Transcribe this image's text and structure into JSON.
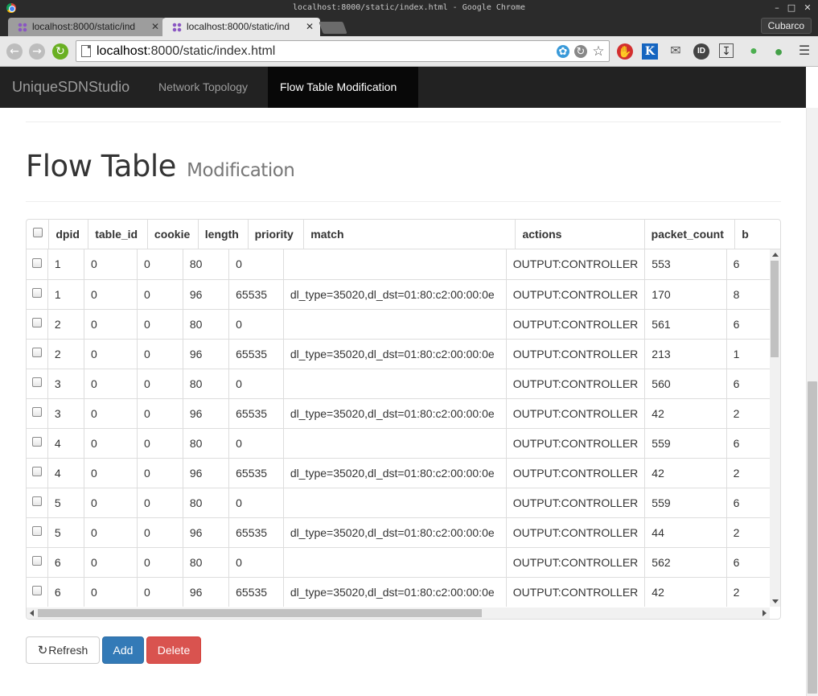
{
  "window": {
    "title": "localhost:8000/static/index.html - Google Chrome",
    "profile": "Cubarco"
  },
  "tabs": [
    {
      "label": "localhost:8000/static/ind",
      "active": false
    },
    {
      "label": "localhost:8000/static/ind",
      "active": true
    }
  ],
  "address_bar": {
    "host": "localhost",
    "path": ":8000/static/index.html"
  },
  "navbar": {
    "brand": "UniqueSDNStudio",
    "links": [
      {
        "label": "Network Topology",
        "active": false
      },
      {
        "label": "Flow Table Modification",
        "active": true
      }
    ]
  },
  "page": {
    "title": "Flow Table",
    "subtitle": "Modification"
  },
  "table": {
    "columns": [
      "dpid",
      "table_id",
      "cookie",
      "length",
      "priority",
      "match",
      "actions",
      "packet_count",
      "b"
    ],
    "rows": [
      [
        "1",
        "0",
        "0",
        "80",
        "0",
        "",
        "OUTPUT:CONTROLLER",
        "553",
        "6"
      ],
      [
        "1",
        "0",
        "0",
        "96",
        "65535",
        "dl_type=35020,dl_dst=01:80:c2:00:00:0e",
        "OUTPUT:CONTROLLER",
        "170",
        "8"
      ],
      [
        "2",
        "0",
        "0",
        "80",
        "0",
        "",
        "OUTPUT:CONTROLLER",
        "561",
        "6"
      ],
      [
        "2",
        "0",
        "0",
        "96",
        "65535",
        "dl_type=35020,dl_dst=01:80:c2:00:00:0e",
        "OUTPUT:CONTROLLER",
        "213",
        "1"
      ],
      [
        "3",
        "0",
        "0",
        "80",
        "0",
        "",
        "OUTPUT:CONTROLLER",
        "560",
        "6"
      ],
      [
        "3",
        "0",
        "0",
        "96",
        "65535",
        "dl_type=35020,dl_dst=01:80:c2:00:00:0e",
        "OUTPUT:CONTROLLER",
        "42",
        "2"
      ],
      [
        "4",
        "0",
        "0",
        "80",
        "0",
        "",
        "OUTPUT:CONTROLLER",
        "559",
        "6"
      ],
      [
        "4",
        "0",
        "0",
        "96",
        "65535",
        "dl_type=35020,dl_dst=01:80:c2:00:00:0e",
        "OUTPUT:CONTROLLER",
        "42",
        "2"
      ],
      [
        "5",
        "0",
        "0",
        "80",
        "0",
        "",
        "OUTPUT:CONTROLLER",
        "559",
        "6"
      ],
      [
        "5",
        "0",
        "0",
        "96",
        "65535",
        "dl_type=35020,dl_dst=01:80:c2:00:00:0e",
        "OUTPUT:CONTROLLER",
        "44",
        "2"
      ],
      [
        "6",
        "0",
        "0",
        "80",
        "0",
        "",
        "OUTPUT:CONTROLLER",
        "562",
        "6"
      ],
      [
        "6",
        "0",
        "0",
        "96",
        "65535",
        "dl_type=35020,dl_dst=01:80:c2:00:00:0e",
        "OUTPUT:CONTROLLER",
        "42",
        "2"
      ]
    ]
  },
  "buttons": {
    "refresh": "Refresh",
    "add": "Add",
    "delete": "Delete"
  },
  "icons": {
    "refresh": "refresh-icon",
    "extensions": [
      "adblock-icon",
      "k-icon",
      "mail-icon",
      "id-icon",
      "download-icon",
      "status-dot-icon",
      "balloon-icon",
      "menu-icon"
    ]
  },
  "colors": {
    "navbar": "#222222",
    "primary": "#337ab7",
    "danger": "#d9534f",
    "active_nav": "#080808"
  }
}
